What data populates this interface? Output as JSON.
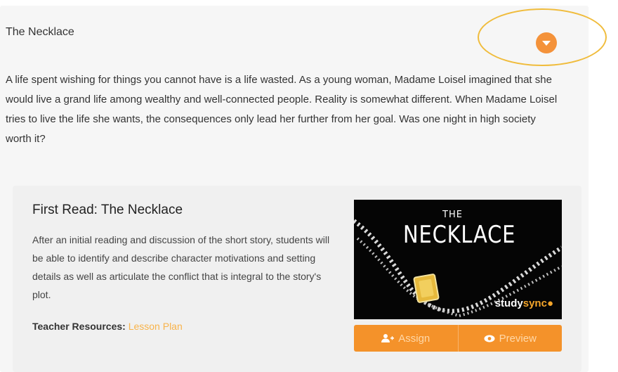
{
  "section": {
    "title": "The Necklace",
    "description": "A life spent wishing for things you cannot have is a life wasted. As a young woman, Madame Loisel imagined that she would live a grand life among wealthy and well-connected people. Reality is somewhat different. When Madame Loisel tries to live the life she wants, the consequences only lead her further from her goal. Was one night in high society worth it?",
    "toggle_icon": "chevron-down-icon",
    "accent_color": "#f4923a",
    "highlight_color": "#f0bc3c"
  },
  "card": {
    "title": "First Read: The Necklace",
    "description": "After an initial reading and discussion of the short story, students will be able to identify and describe character motivations and setting details as well as articulate the conflict that is integral to the story's plot.",
    "resources_label": "Teacher Resources:",
    "resources_link": "Lesson Plan",
    "thumbnail": {
      "line1": "THE",
      "line2": "NECKLACE",
      "brand_study": "study",
      "brand_sync": "sync",
      "brand_dot": "●"
    },
    "buttons": {
      "assign_label": "Assign",
      "assign_icon": "add-user-icon",
      "preview_label": "Preview",
      "preview_icon": "eye-icon"
    }
  }
}
